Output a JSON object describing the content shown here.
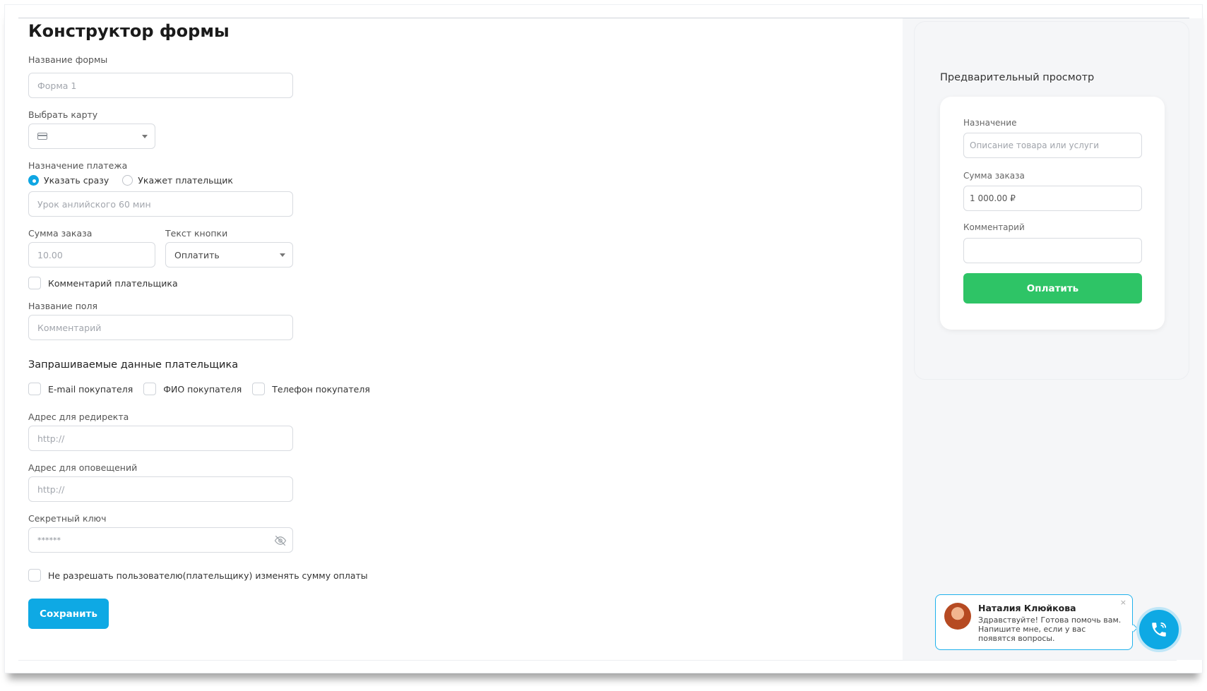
{
  "page": {
    "title": "Конструктор формы"
  },
  "form": {
    "name_label": "Название формы",
    "name_placeholder": "Форма 1",
    "card_label": "Выбрать карту",
    "purpose_label": "Назначение платежа",
    "purpose_options": [
      "Указать сразу",
      "Укажет плательщик"
    ],
    "purpose_placeholder": "Урок анлийского 60 мин",
    "amount_label": "Сумма заказа",
    "amount_placeholder": "10.00",
    "button_text_label": "Текст кнопки",
    "button_text_value": "Оплатить",
    "payer_comment_label": "Комментарий плательщика",
    "field_name_label": "Название поля",
    "field_name_placeholder": "Комментарий",
    "payer_data_title": "Запрашиваемые данные плательщика",
    "payer_data_options": [
      "E-mail покупателя",
      "ФИО покупателя",
      "Телефон покупателя"
    ],
    "redirect_label": "Адрес для редиректа",
    "redirect_placeholder": "http://",
    "notify_label": "Адрес для оповещений",
    "notify_placeholder": "http://",
    "secret_label": "Секретный ключ",
    "secret_value": "******",
    "lock_amount_label": "Не разрешать пользователю(плательщику) изменять сумму оплаты",
    "save_label": "Сохранить"
  },
  "preview": {
    "title": "Предварительный просмотр",
    "purpose_label": "Назначение",
    "purpose_placeholder": "Описание товара или услуги",
    "amount_label": "Сумма заказа",
    "amount_value": "1 000.00 ₽",
    "comment_label": "Комментарий",
    "pay_label": "Оплатить"
  },
  "chat": {
    "name": "Наталия Клюйкова",
    "message": "Здравствуйте! Готова помочь вам. Напишите мне, если у вас появятся вопросы.",
    "close": "×"
  },
  "colors": {
    "accent": "#0ea9e4",
    "pay_button": "#2ec466",
    "preview_bg": "#f5f6f8"
  },
  "icons": [
    "card-icon",
    "caret-down-icon",
    "eye-off-icon",
    "phone-icon",
    "close-icon"
  ]
}
